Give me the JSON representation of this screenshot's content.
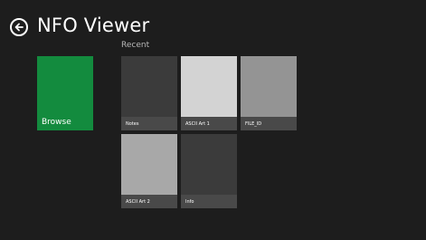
{
  "header": {
    "back_icon": "back-arrow-icon",
    "title": "NFO Viewer"
  },
  "recent": {
    "label": "Recent"
  },
  "browse": {
    "label": "Browse",
    "color": "#138b3e"
  },
  "files": [
    {
      "name": "Notes",
      "thumb_color": "#3b3b3b"
    },
    {
      "name": "ASCII Art 1",
      "thumb_color": "#d3d3d3"
    },
    {
      "name": "FILE_ID",
      "thumb_color": "#949494"
    },
    {
      "name": "ASCII Art 2",
      "thumb_color": "#a8a8a8"
    },
    {
      "name": "Info",
      "thumb_color": "#3b3b3b"
    }
  ]
}
